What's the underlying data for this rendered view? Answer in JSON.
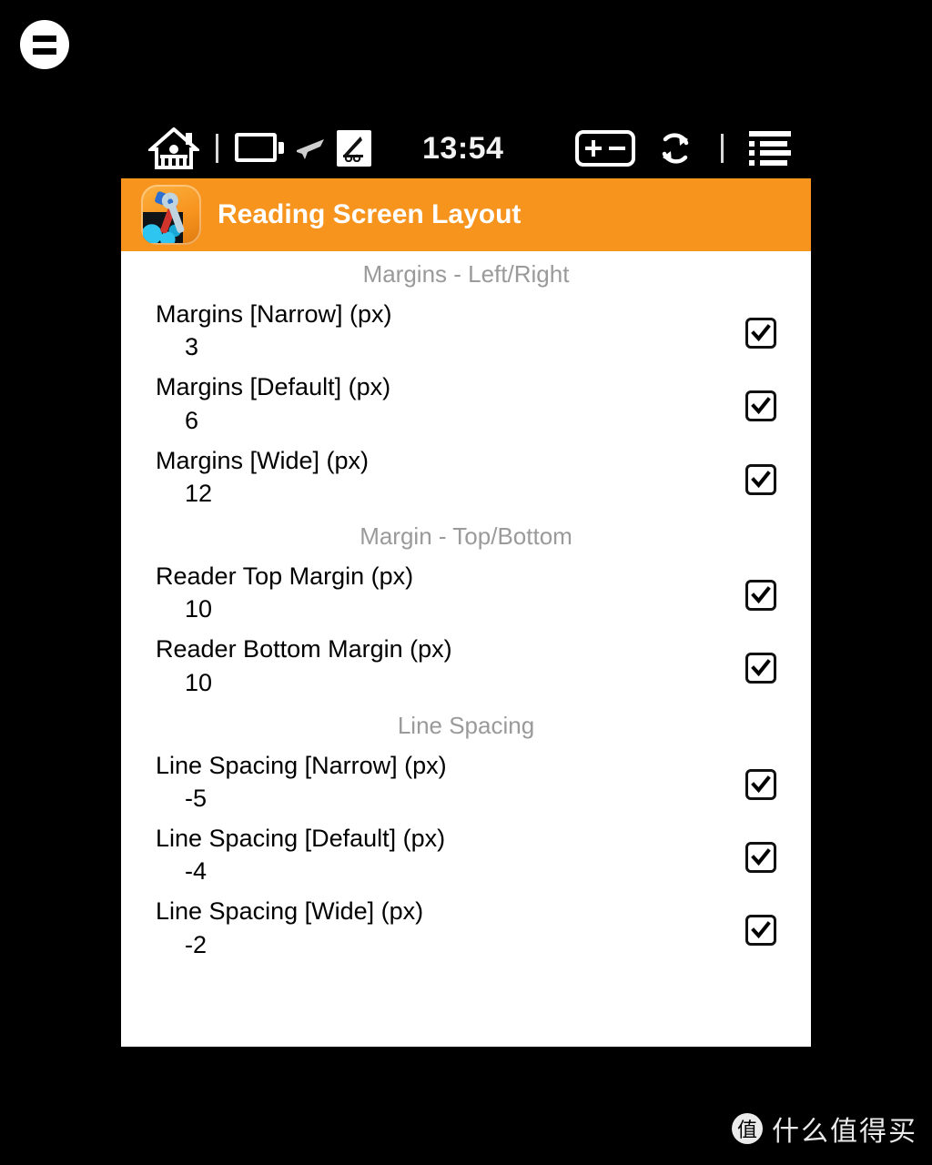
{
  "corner": {
    "icon": "equals-menu-icon"
  },
  "statusbar": {
    "home_icon": "home-icon",
    "battery_icon": "battery-icon",
    "airplane_icon": "airplane-mode-icon",
    "satellite_icon": "satellite-dish-icon",
    "time": "13:54",
    "plusminus_icon": "plus-minus-box-icon",
    "refresh_icon": "refresh-icon",
    "list_icon": "list-menu-icon"
  },
  "titlebar": {
    "app_icon": "hammer-wrench-app-icon",
    "title": "Reading Screen Layout",
    "accent_color": "#F7941E"
  },
  "panel": {
    "sections": [
      {
        "header": "Margins - Left/Right",
        "rows": [
          {
            "title": "Margins [Narrow] (px)",
            "value": "3",
            "checked": true
          },
          {
            "title": "Margins [Default] (px)",
            "value": "6",
            "checked": true
          },
          {
            "title": "Margins [Wide] (px)",
            "value": "12",
            "checked": true
          }
        ]
      },
      {
        "header": "Margin - Top/Bottom",
        "rows": [
          {
            "title": "Reader Top Margin (px)",
            "value": "10",
            "checked": true
          },
          {
            "title": "Reader Bottom Margin (px)",
            "value": "10",
            "checked": true
          }
        ]
      },
      {
        "header": "Line Spacing",
        "rows": [
          {
            "title": "Line Spacing [Narrow] (px)",
            "value": "-5",
            "checked": true
          },
          {
            "title": "Line Spacing [Default] (px)",
            "value": "-4",
            "checked": true
          },
          {
            "title": "Line Spacing [Wide] (px)",
            "value": "-2",
            "checked": true
          }
        ]
      }
    ]
  },
  "watermark": {
    "badge": "值",
    "text": "什么值得买"
  }
}
